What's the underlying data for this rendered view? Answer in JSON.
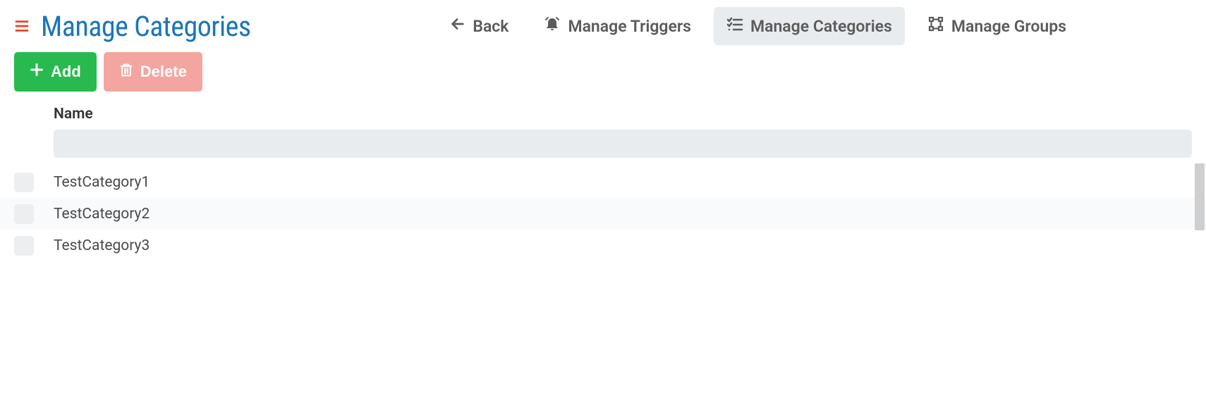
{
  "header": {
    "title": "Manage Categories"
  },
  "nav": {
    "back": "Back",
    "triggers": "Manage Triggers",
    "categories": "Manage Categories",
    "groups": "Manage Groups"
  },
  "toolbar": {
    "add_label": "Add",
    "delete_label": "Delete"
  },
  "table": {
    "name_header": "Name",
    "filter_value": "",
    "rows": [
      {
        "name": "TestCategory1"
      },
      {
        "name": "TestCategory2"
      },
      {
        "name": "TestCategory3"
      }
    ]
  }
}
